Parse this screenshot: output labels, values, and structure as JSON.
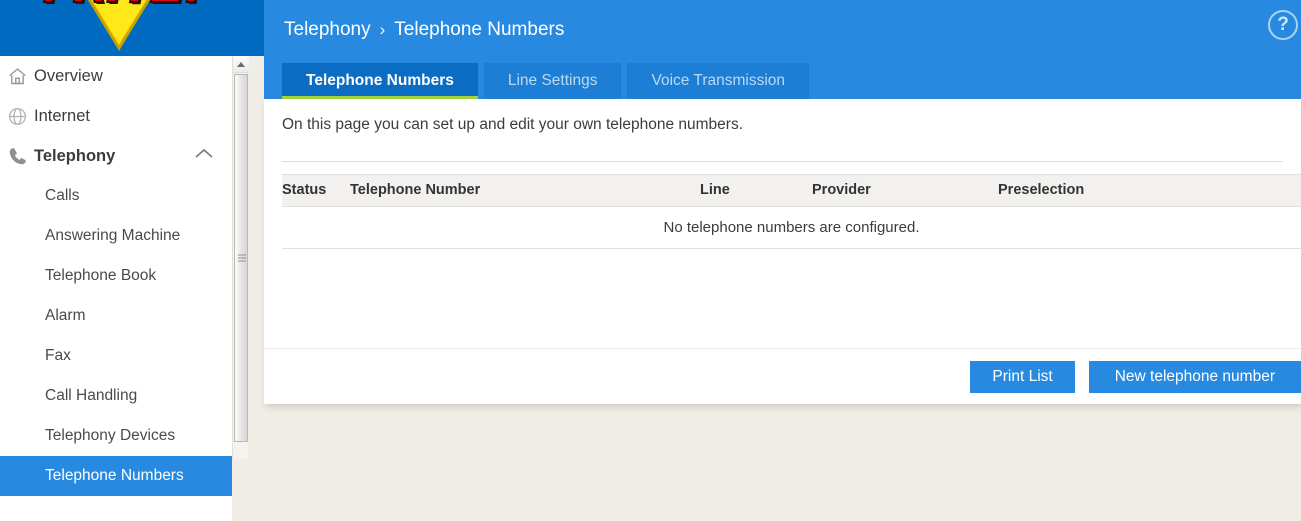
{
  "brand": {
    "logo_text": "FRITZ!",
    "logo_color": "#e2001a",
    "band_color": "#0069c0"
  },
  "header": {
    "breadcrumb": {
      "parent": "Telephony",
      "separator": "›",
      "current": "Telephone Numbers"
    },
    "help_icon_label": "?",
    "accent_color": "#2789df",
    "tabs": [
      {
        "label": "Telephone Numbers",
        "active": true
      },
      {
        "label": "Line Settings",
        "active": false
      },
      {
        "label": "Voice Transmission",
        "active": false
      }
    ],
    "active_tab_underline_color": "#a3d43a"
  },
  "sidebar": {
    "items": [
      {
        "label": "Overview",
        "icon": "home-icon",
        "level": "top"
      },
      {
        "label": "Internet",
        "icon": "globe-icon",
        "level": "top"
      },
      {
        "label": "Telephony",
        "icon": "phone-icon",
        "level": "top",
        "expanded": true,
        "chevron": "chevron-up-icon"
      },
      {
        "label": "Calls",
        "level": "sub"
      },
      {
        "label": "Answering Machine",
        "level": "sub"
      },
      {
        "label": "Telephone Book",
        "level": "sub"
      },
      {
        "label": "Alarm",
        "level": "sub"
      },
      {
        "label": "Fax",
        "level": "sub"
      },
      {
        "label": "Call Handling",
        "level": "sub"
      },
      {
        "label": "Telephony Devices",
        "level": "sub"
      },
      {
        "label": "Telephone Numbers",
        "level": "sub",
        "active": true
      }
    ],
    "active_color": "#2789df"
  },
  "main": {
    "intro_text": "On this page you can set up and edit your own telephone numbers.",
    "table": {
      "columns": [
        "Status",
        "Telephone Number",
        "Line",
        "Provider",
        "Preselection"
      ],
      "rows": [],
      "empty_message": "No telephone numbers are configured."
    },
    "buttons": [
      {
        "label": "Print List",
        "style": "secondary"
      },
      {
        "label": "New telephone number",
        "style": "primary"
      }
    ]
  }
}
